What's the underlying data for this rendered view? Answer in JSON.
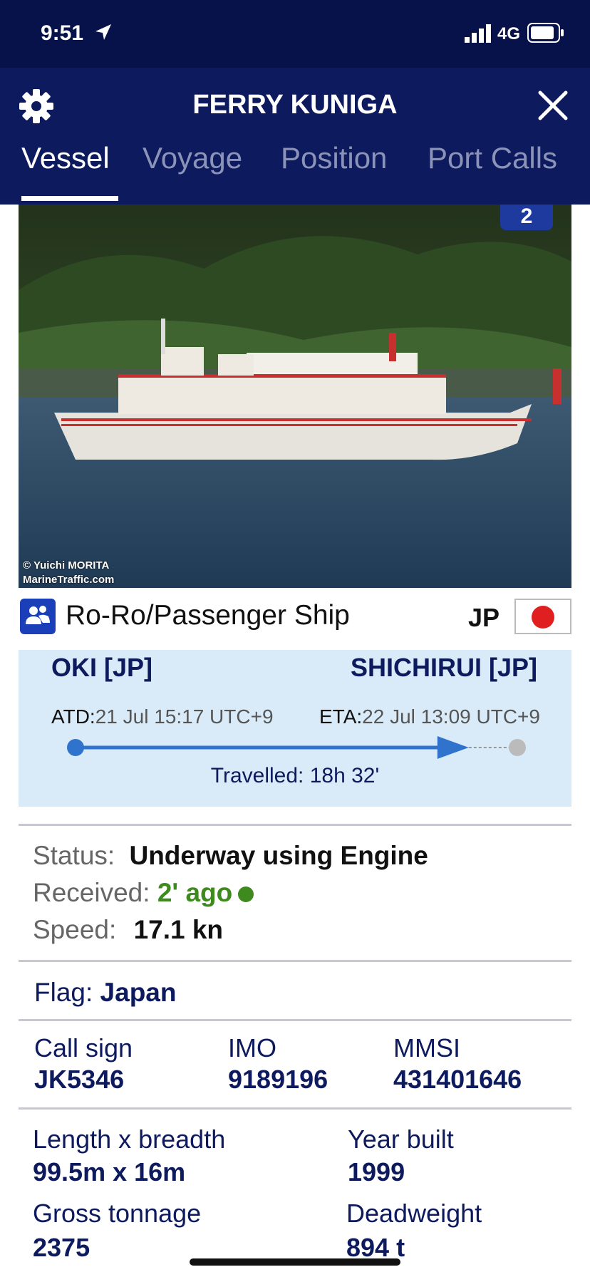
{
  "status_bar": {
    "time": "9:51",
    "network": "4G"
  },
  "header": {
    "title": "FERRY KUNIGA",
    "tabs": [
      {
        "label": "Vessel",
        "active": true
      },
      {
        "label": "Voyage",
        "active": false
      },
      {
        "label": "Position",
        "active": false
      },
      {
        "label": "Port Calls",
        "active": false
      }
    ]
  },
  "photo": {
    "count_badge": "2",
    "credit_line1": "© Yuichi MORITA",
    "credit_line2": "MarineTraffic.com"
  },
  "vessel_type": {
    "label": "Ro-Ro/Passenger Ship",
    "flag_code": "JP",
    "icon": "passenger-ship-icon"
  },
  "route": {
    "from": "OKI [JP]",
    "to": "SHICHIRUI [JP]",
    "atd_label": "ATD:",
    "atd_value": "21 Jul 15:17 UTC+9",
    "eta_label": "ETA:",
    "eta_value": "22 Jul 13:09 UTC+9",
    "travelled": "Travelled: 18h 32'",
    "progress_fraction": 0.89
  },
  "status": {
    "status_label": "Status:",
    "status_value": "Underway using Engine",
    "received_label": "Received:",
    "received_value": "2' ago",
    "speed_label": "Speed:",
    "speed_value": "17.1 kn"
  },
  "flag": {
    "label": "Flag:",
    "value": "Japan"
  },
  "ids": {
    "call_sign_label": "Call sign",
    "call_sign": "JK5346",
    "imo_label": "IMO",
    "imo": "9189196",
    "mmsi_label": "MMSI",
    "mmsi": "431401646"
  },
  "dimensions": {
    "length_label": "Length x breadth",
    "length_value": "99.5m x 16m",
    "year_label": "Year built",
    "year_value": "1999",
    "gross_label": "Gross tonnage",
    "gross_value": "2375",
    "deadweight_label": "Deadweight",
    "deadweight_value": "894 t"
  },
  "colors": {
    "header_bg": "#0d1a5e",
    "status_bg": "#08124a",
    "route_bg": "#d9ebf8",
    "track_blue": "#2f73cc",
    "green": "#3f8a1e"
  }
}
